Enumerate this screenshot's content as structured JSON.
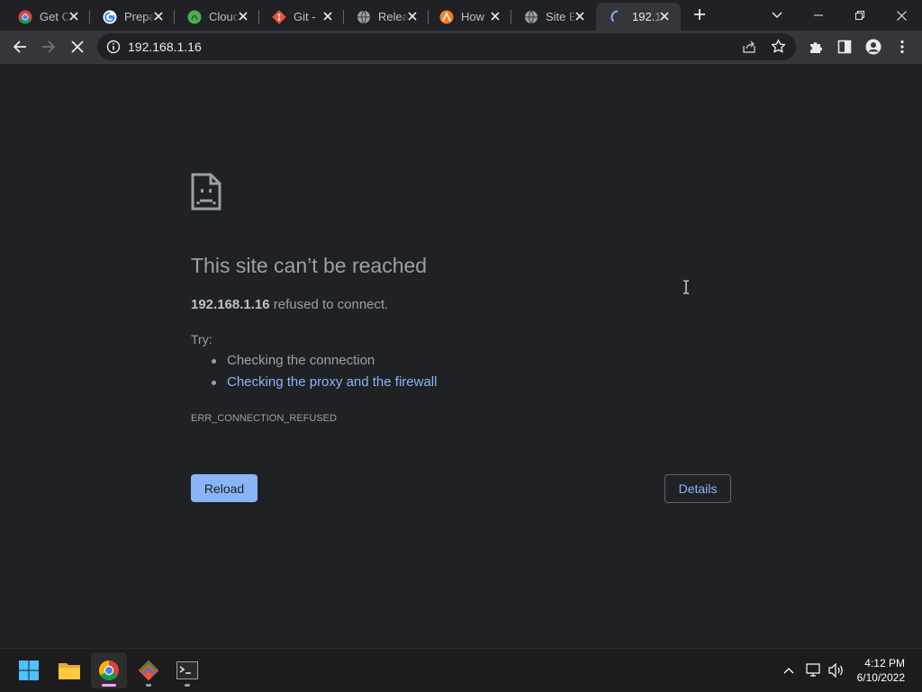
{
  "tabs": [
    {
      "title": "Get C",
      "favicon": "chrome-icon"
    },
    {
      "title": "Prepa",
      "favicon": "google-icon"
    },
    {
      "title": "Clouc",
      "favicon": "cloud-shell-icon"
    },
    {
      "title": "Git - ",
      "favicon": "git-icon"
    },
    {
      "title": "Relea",
      "favicon": "globe-icon"
    },
    {
      "title": "How",
      "favicon": "orange-app-icon"
    },
    {
      "title": "Site E",
      "favicon": "globe-icon"
    },
    {
      "title": "192.1",
      "favicon": "loading-spinner-icon",
      "active": true
    }
  ],
  "toolbar": {
    "url": "192.168.1.16"
  },
  "error": {
    "heading": "This site can’t be reached",
    "host": "192.168.1.16",
    "summary_rest": " refused to connect.",
    "try_label": "Try:",
    "suggestions": [
      "Checking the connection",
      "Checking the proxy and the firewall"
    ],
    "error_code": "ERR_CONNECTION_REFUSED",
    "reload_label": "Reload",
    "details_label": "Details"
  },
  "taskbar": {
    "apps": [
      "windows-start-icon",
      "file-explorer-icon",
      "chrome-icon",
      "git-gui-icon",
      "terminal-icon"
    ],
    "time": "4:12 PM",
    "date": "6/10/2022"
  },
  "colors": {
    "background": "#202124",
    "toolbar": "#35363a",
    "link": "#8ab4f8",
    "text": "#9aa0a6"
  }
}
